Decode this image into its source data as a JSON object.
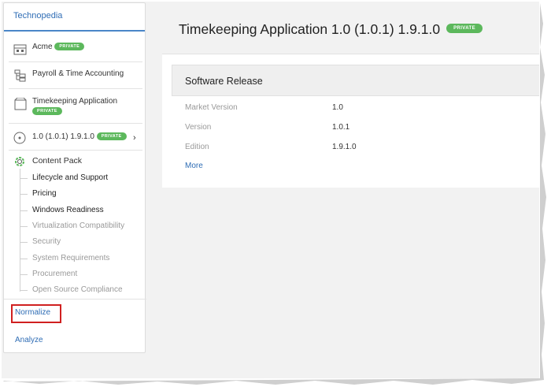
{
  "sidebar": {
    "root": "Technopedia",
    "items": [
      {
        "label": "Acme",
        "badge": "PRIVATE",
        "icon": "building-icon"
      },
      {
        "label": "Payroll & Time Accounting",
        "icon": "category-tree-icon"
      },
      {
        "label": "Timekeeping Application",
        "badge": "PRIVATE",
        "icon": "box-icon"
      },
      {
        "label": "1.0 (1.0.1) 1.9.1.0",
        "badge": "PRIVATE",
        "icon": "disc-icon"
      },
      {
        "label": "Content Pack",
        "icon": "gear-icon"
      }
    ],
    "tree": [
      {
        "label": "Lifecycle and Support",
        "dim": false
      },
      {
        "label": "Pricing",
        "dim": false
      },
      {
        "label": "Windows Readiness",
        "dim": false
      },
      {
        "label": "Virtualization Compatibility",
        "dim": true
      },
      {
        "label": "Security",
        "dim": true
      },
      {
        "label": "System Requirements",
        "dim": true
      },
      {
        "label": "Procurement",
        "dim": true
      },
      {
        "label": "Open Source Compliance",
        "dim": true
      }
    ],
    "links": {
      "normalize": "Normalize",
      "analyze": "Analyze"
    }
  },
  "main": {
    "title": "Timekeeping Application 1.0 (1.0.1) 1.9.1.0",
    "badge": "PRIVATE",
    "card": {
      "header": "Software Release",
      "rows": [
        {
          "key": "Market Version",
          "value": "1.0"
        },
        {
          "key": "Version",
          "value": "1.0.1"
        },
        {
          "key": "Edition",
          "value": "1.9.1.0"
        }
      ],
      "more": "More"
    }
  },
  "colors": {
    "accent": "#2f6db5",
    "badge": "#5cb85c",
    "highlight": "#d02020"
  }
}
